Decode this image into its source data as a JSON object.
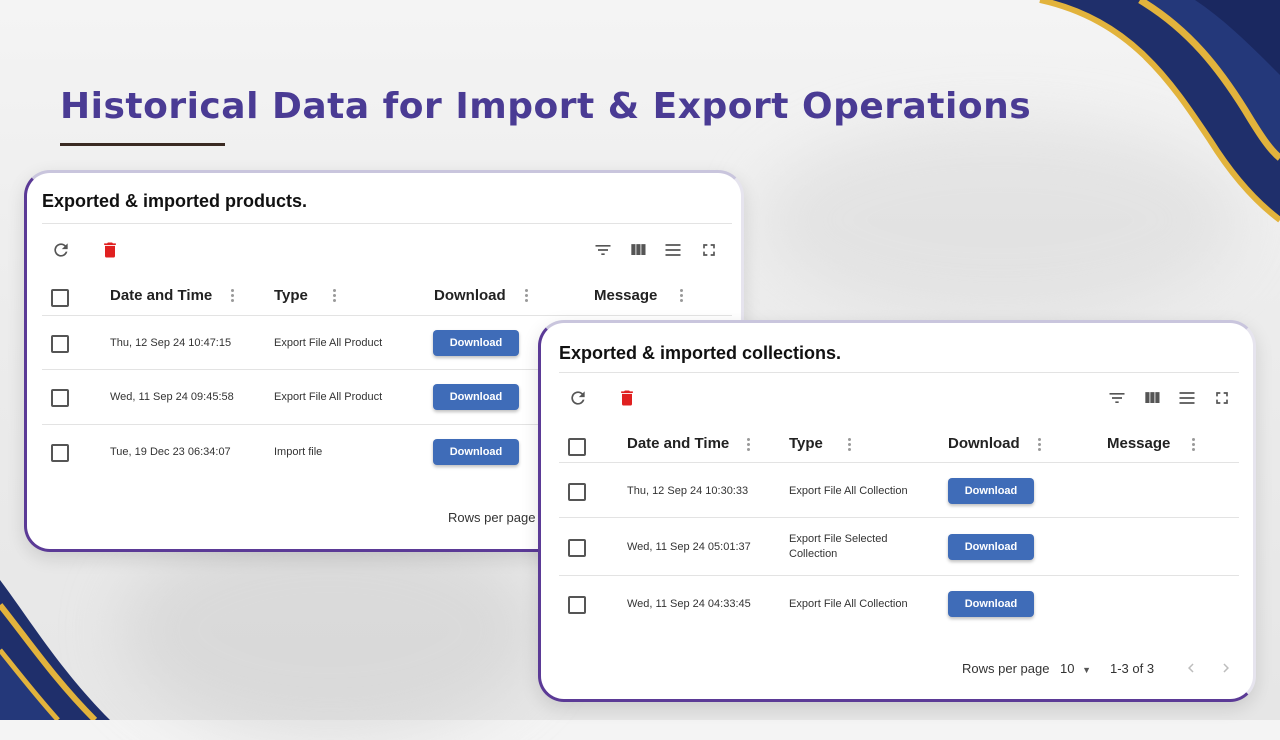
{
  "headline": "Historical Data for Import & Export Operations",
  "products_card": {
    "title": "Exported & imported products.",
    "columns": [
      "Date and Time",
      "Type",
      "Download",
      "Message"
    ],
    "rows": [
      {
        "date": "Thu, 12 Sep 24 10:47:15",
        "type": "Export File All Product",
        "download": "Download"
      },
      {
        "date": "Wed, 11 Sep 24 09:45:58",
        "type": "Export File All Product",
        "download": "Download"
      },
      {
        "date": "Tue, 19 Dec 23 06:34:07",
        "type": "Import file",
        "download": "Download"
      }
    ],
    "rows_per_page_label": "Rows per page"
  },
  "collections_card": {
    "title": "Exported & imported collections.",
    "columns": [
      "Date and Time",
      "Type",
      "Download",
      "Message"
    ],
    "rows": [
      {
        "date": "Thu, 12 Sep 24 10:30:33",
        "type": "Export File All Collection",
        "download": "Download"
      },
      {
        "date": "Wed, 11 Sep 24 05:01:37",
        "type": "Export File Selected Collection",
        "download": "Download"
      },
      {
        "date": "Wed, 11 Sep 24 04:33:45",
        "type": "Export File All Collection",
        "download": "Download"
      }
    ],
    "rows_per_page_label": "Rows per page",
    "rows_per_page_value": "10",
    "range": "1-3 of 3"
  },
  "colors": {
    "accent": "#4a3b94",
    "button": "#3f6cb8",
    "delete": "#e02020",
    "border": "#5b3a96",
    "navy": "#1f2f6b",
    "gold": "#e2b33c"
  },
  "icons": [
    "refresh-icon",
    "delete-icon",
    "filter-icon",
    "columns-icon",
    "density-icon",
    "fullscreen-icon",
    "chevron-left-icon",
    "chevron-right-icon",
    "dropdown-arrow-icon"
  ]
}
